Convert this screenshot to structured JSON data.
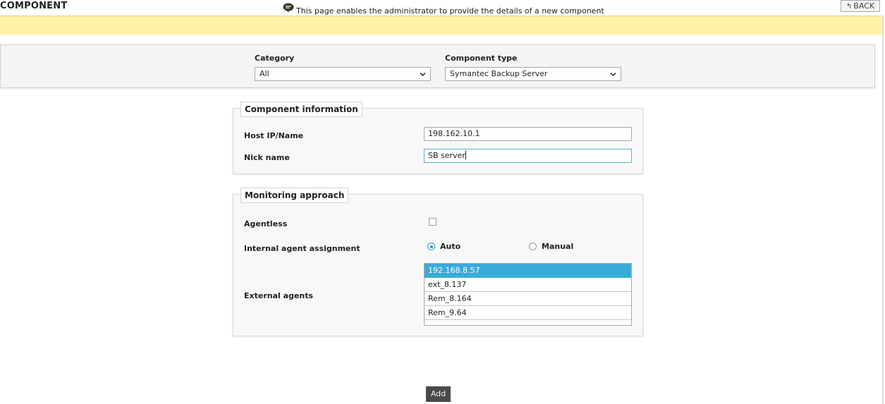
{
  "header": {
    "title": "COMPONENT",
    "back_label": "BACK",
    "info_message": "This page enables the administrator to provide the details of a new component"
  },
  "filters": {
    "category_label": "Category",
    "category_value": "All",
    "component_type_label": "Component type",
    "component_type_value": "Symantec Backup Server"
  },
  "component_information": {
    "legend": "Component information",
    "host_label": "Host IP/Name",
    "host_value": "198.162.10.1",
    "nick_label": "Nick name",
    "nick_value": "SB server"
  },
  "monitoring_approach": {
    "legend": "Monitoring approach",
    "agentless_label": "Agentless",
    "agentless_checked": false,
    "internal_label": "Internal agent assignment",
    "internal_options": [
      {
        "label": "Auto",
        "selected": true
      },
      {
        "label": "Manual",
        "selected": false
      }
    ],
    "external_label": "External agents",
    "external_agents": [
      {
        "label": "192.168.8.57",
        "selected": true
      },
      {
        "label": "ext_8.137",
        "selected": false
      },
      {
        "label": "Rem_8.164",
        "selected": false
      },
      {
        "label": "Rem_9.64",
        "selected": false
      }
    ]
  },
  "actions": {
    "add_label": "Add"
  },
  "colors": {
    "info_bar_bg": "#fdf2a6",
    "selected_item_bg": "#3aabd9",
    "radio_accent": "#2e9bc8",
    "add_button_bg": "#4a4a4a"
  },
  "icons": {
    "back": "reply-arrow-icon",
    "info": "speech-bubble-icon",
    "dropdown": "chevron-down-icon"
  }
}
